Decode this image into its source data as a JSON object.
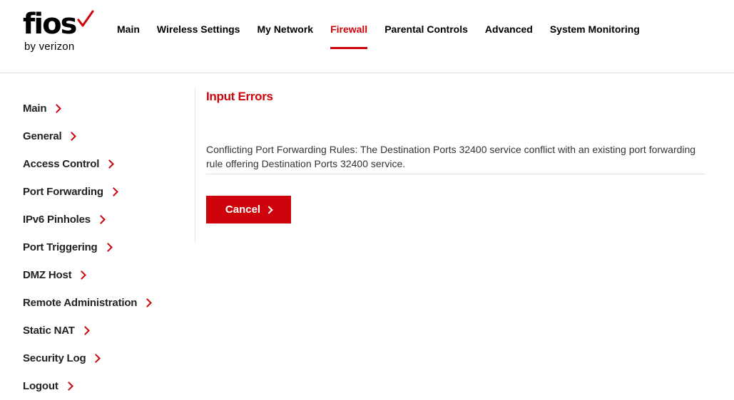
{
  "logo": {
    "brand": "fios",
    "sub": "by verizon",
    "accent": "#cd040b"
  },
  "nav": [
    {
      "label": "Main",
      "active": false
    },
    {
      "label": "Wireless Settings",
      "active": false
    },
    {
      "label": "My Network",
      "active": false
    },
    {
      "label": "Firewall",
      "active": true
    },
    {
      "label": "Parental Controls",
      "active": false
    },
    {
      "label": "Advanced",
      "active": false
    },
    {
      "label": "System Monitoring",
      "active": false
    }
  ],
  "sidebar": {
    "items": [
      {
        "label": "Main",
        "icon": "chevron-right-icon"
      },
      {
        "label": "General",
        "icon": "chevron-right-icon"
      },
      {
        "label": "Access Control",
        "icon": "chevron-right-icon"
      },
      {
        "label": "Port Forwarding",
        "icon": "chevron-right-icon"
      },
      {
        "label": "IPv6 Pinholes",
        "icon": "chevron-right-icon"
      },
      {
        "label": "Port Triggering",
        "icon": "chevron-right-icon"
      },
      {
        "label": "DMZ Host",
        "icon": "chevron-right-icon"
      },
      {
        "label": "Remote Administration",
        "icon": "chevron-right-icon"
      },
      {
        "label": "Static NAT",
        "icon": "chevron-right-icon"
      },
      {
        "label": "Security Log",
        "icon": "chevron-right-icon"
      },
      {
        "label": "Logout",
        "icon": "chevron-right-icon"
      }
    ]
  },
  "main": {
    "title": "Input Errors",
    "message": "Conflicting Port Forwarding Rules: The Destination Ports 32400 service conflict with an existing port forwarding rule offering Destination Ports 32400 service.",
    "cancel_label": "Cancel"
  }
}
